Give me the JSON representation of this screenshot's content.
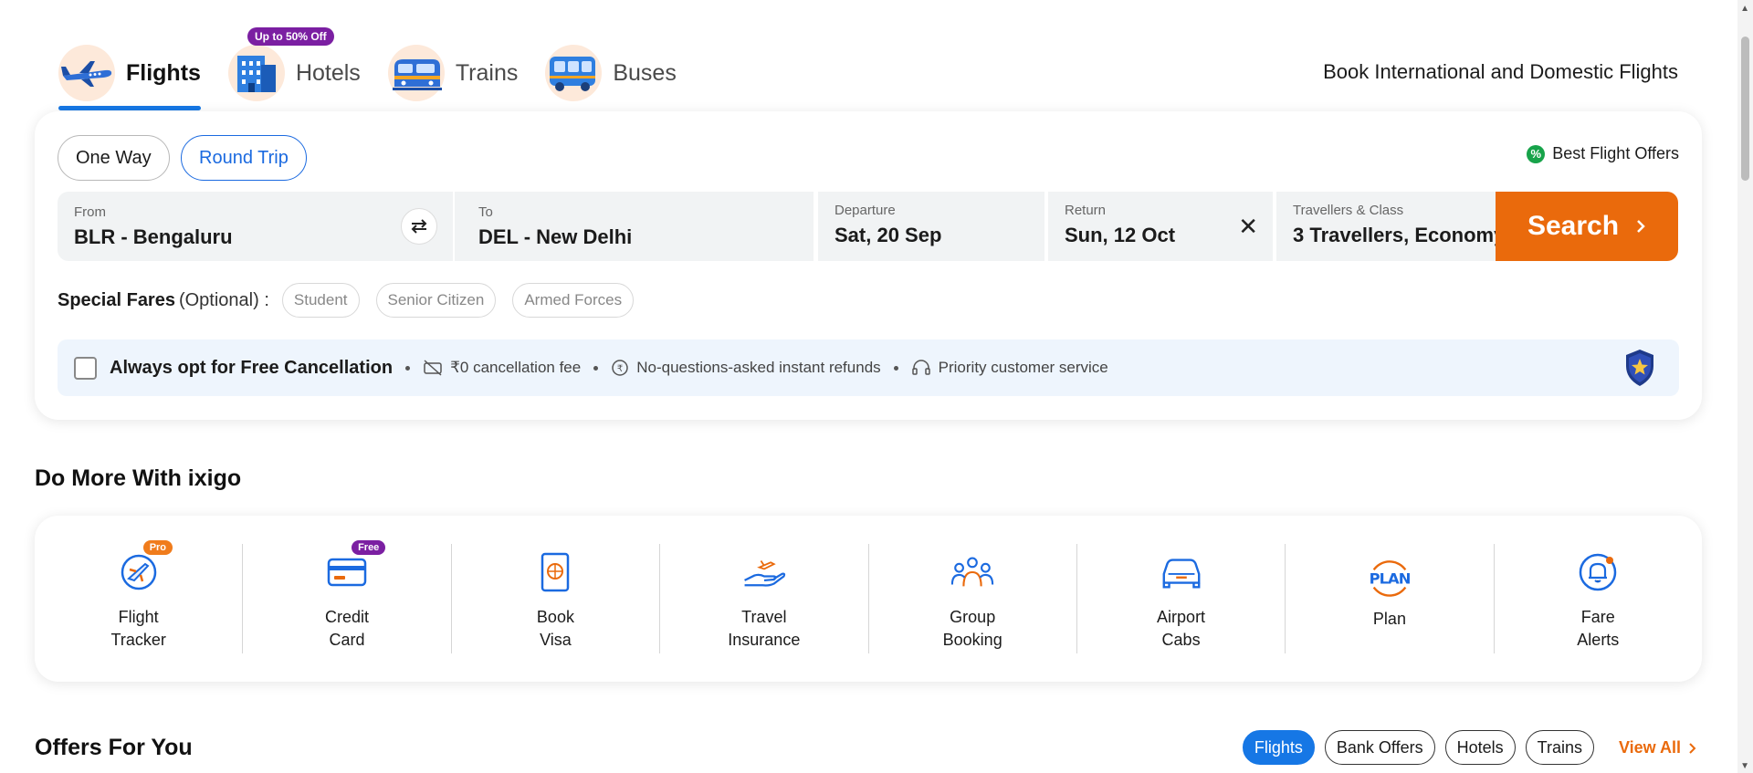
{
  "header": {
    "tabs": [
      {
        "label": "Flights",
        "active": true,
        "icon": "airplane-icon"
      },
      {
        "label": "Hotels",
        "active": false,
        "icon": "hotel-building-icon",
        "badge": "Up to 50% Off"
      },
      {
        "label": "Trains",
        "active": false,
        "icon": "train-icon"
      },
      {
        "label": "Buses",
        "active": false,
        "icon": "bus-icon"
      }
    ],
    "tagline": "Book International and Domestic Flights"
  },
  "search": {
    "trip_types": [
      "One Way",
      "Round Trip"
    ],
    "selected_trip": "Round Trip",
    "best_offers": "Best Flight Offers",
    "from": {
      "label": "From",
      "value": "BLR - Bengaluru"
    },
    "to": {
      "label": "To",
      "value": "DEL - New Delhi"
    },
    "departure": {
      "label": "Departure",
      "value": "Sat, 20 Sep"
    },
    "return": {
      "label": "Return",
      "value": "Sun, 12 Oct"
    },
    "travellers": {
      "label": "Travellers & Class",
      "value": "3 Travellers, Economy"
    },
    "search_label": "Search",
    "special_fares": {
      "title": "Special Fares",
      "optional": "(Optional) :",
      "options": [
        "Student",
        "Senior Citizen",
        "Armed Forces"
      ]
    },
    "free_cancellation": {
      "title": "Always opt for Free Cancellation",
      "checked": false,
      "benefits": [
        "₹0 cancellation fee",
        "No-questions-asked instant refunds",
        "Priority customer service"
      ]
    }
  },
  "do_more": {
    "title": "Do More With ixigo",
    "items": [
      {
        "line1": "Flight",
        "line2": "Tracker",
        "badge": "Pro",
        "icon": "flight-tracker-icon"
      },
      {
        "line1": "Credit",
        "line2": "Card",
        "badge": "Free",
        "icon": "credit-card-icon"
      },
      {
        "line1": "Book",
        "line2": "Visa",
        "icon": "visa-passport-icon"
      },
      {
        "line1": "Travel",
        "line2": "Insurance",
        "icon": "insurance-hand-icon"
      },
      {
        "line1": "Group",
        "line2": "Booking",
        "icon": "group-icon"
      },
      {
        "line1": "Airport",
        "line2": "Cabs",
        "icon": "cab-icon"
      },
      {
        "line1": "Plan",
        "line2": "",
        "icon": "plan-icon"
      },
      {
        "line1": "Fare",
        "line2": "Alerts",
        "icon": "bell-icon"
      }
    ]
  },
  "offers": {
    "title": "Offers For You",
    "tabs": [
      "Flights",
      "Bank Offers",
      "Hotels",
      "Trains"
    ],
    "active_tab": "Flights",
    "view_all": "View All"
  },
  "colors": {
    "accent_blue": "#1677e5",
    "search_orange": "#ea6a0c",
    "pro_badge": "#f07c1c",
    "free_badge": "#7b1fa2"
  }
}
